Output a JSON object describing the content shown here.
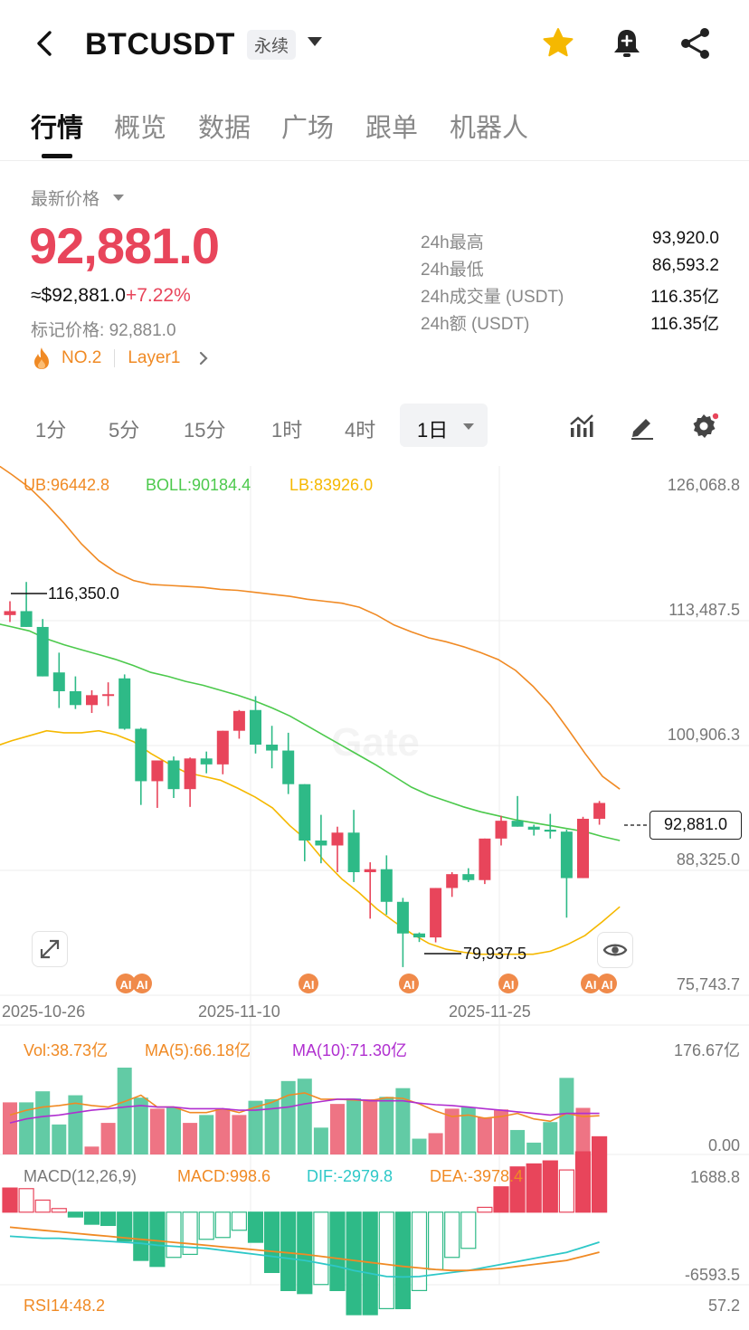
{
  "header": {
    "symbol": "BTCUSDT",
    "contract_type": "永续"
  },
  "tabs": [
    "行情",
    "概览",
    "数据",
    "广场",
    "跟单",
    "机器人"
  ],
  "price": {
    "label": "最新价格",
    "last": "92,881.0",
    "usd": "≈$92,881.0",
    "change": "+7.22%",
    "mark_label": "标记价格:",
    "mark": "92,881.0",
    "rank": "NO.2",
    "category": "Layer1",
    "up_color": "#e8455b",
    "down_color": "#2eba87"
  },
  "stats": [
    {
      "label": "24h最高",
      "value": "93,920.0"
    },
    {
      "label": "24h最低",
      "value": "86,593.2"
    },
    {
      "label": "24h成交量 (USDT)",
      "value": "116.35亿"
    },
    {
      "label": "24h额 (USDT)",
      "value": "116.35亿"
    }
  ],
  "intervals": [
    "1分",
    "5分",
    "15分",
    "1时",
    "4时"
  ],
  "active_interval": "1日",
  "indicators": {
    "boll": {
      "ub": "UB:96442.8",
      "mid": "BOLL:90184.4",
      "lb": "LB:83926.0"
    },
    "vol": {
      "vol": "Vol:38.73亿",
      "ma5": "MA(5):66.18亿",
      "ma10": "MA(10):71.30亿",
      "max": "176.67亿",
      "min": "0.00"
    },
    "macd": {
      "name": "MACD(12,26,9)",
      "macd": "MACD:998.6",
      "dif": "DIF:-2979.8",
      "dea": "DEA:-3978.4",
      "max": "1688.8",
      "min": "-6593.5"
    },
    "rsi": {
      "name": "RSI14:48.2",
      "max": "57.2"
    }
  },
  "chart_data": {
    "type": "candlestick",
    "price_axis": [
      "126,068.8",
      "113,487.5",
      "100,906.3",
      "88,325.0",
      "75,743.7"
    ],
    "ylim": [
      75743.7,
      126068.8
    ],
    "x_ticks": [
      "2025-10-26",
      "2025-11-10",
      "2025-11-25"
    ],
    "high_marker": "116,350.0",
    "low_marker": "79,937.5",
    "current_price": "92,881.0",
    "ai_markers": [
      "AI",
      "AI",
      "AI",
      "AI",
      "AI",
      "AI",
      "AI"
    ],
    "ohlc": [
      [
        113000,
        114400,
        112300,
        113400
      ],
      [
        113400,
        116350,
        112500,
        111800
      ],
      [
        111800,
        112600,
        106900,
        106800
      ],
      [
        107200,
        109200,
        103600,
        105300
      ],
      [
        105300,
        106800,
        103500,
        103900
      ],
      [
        103900,
        105400,
        103100,
        104900
      ],
      [
        104900,
        106200,
        103800,
        105000
      ],
      [
        106600,
        107000,
        101400,
        101500
      ],
      [
        101500,
        101600,
        93800,
        96200
      ],
      [
        96200,
        97800,
        93500,
        98300
      ],
      [
        98300,
        98700,
        94500,
        95400
      ],
      [
        95400,
        98600,
        93600,
        98500
      ],
      [
        98500,
        99200,
        97000,
        97900
      ],
      [
        97900,
        101300,
        96900,
        101300
      ],
      [
        101300,
        103400,
        100500,
        103300
      ],
      [
        103400,
        104800,
        99000,
        99900
      ],
      [
        99900,
        101800,
        97500,
        99300
      ],
      [
        99300,
        101100,
        94900,
        95900
      ],
      [
        95900,
        95900,
        88100,
        90200
      ],
      [
        90200,
        92800,
        87900,
        89700
      ],
      [
        89700,
        91600,
        87000,
        91000
      ],
      [
        91000,
        93300,
        86000,
        87000
      ],
      [
        87000,
        88000,
        82300,
        87300
      ],
      [
        87300,
        88700,
        82700,
        84000
      ],
      [
        84000,
        84400,
        77400,
        80800
      ],
      [
        80800,
        80900,
        79937.5,
        80400
      ],
      [
        80400,
        84500,
        79900,
        85400
      ],
      [
        85400,
        87000,
        84500,
        86800
      ],
      [
        86800,
        87400,
        86000,
        86200
      ],
      [
        86200,
        90100,
        85800,
        90400
      ],
      [
        90400,
        92700,
        89700,
        92200
      ],
      [
        92200,
        94700,
        91600,
        91600
      ],
      [
        91600,
        91800,
        90700,
        91300
      ],
      [
        91300,
        92900,
        90400,
        91100
      ],
      [
        91100,
        91300,
        82400,
        86400
      ],
      [
        86400,
        92600,
        86400,
        92400
      ],
      [
        92400,
        94200,
        91800,
        94000
      ]
    ],
    "ub": [
      128400,
      127200,
      125900,
      124200,
      122300,
      120200,
      118500,
      117300,
      116500,
      116100,
      116000,
      115900,
      115800,
      115600,
      115500,
      115300,
      115100,
      114900,
      114600,
      114400,
      114200,
      113800,
      113000,
      112000,
      111300,
      110700,
      110300,
      109800,
      109200,
      108500,
      107400,
      105800,
      103900,
      101500,
      99000,
      96700,
      95400
    ],
    "mid": [
      112200,
      111800,
      111400,
      110600,
      110000,
      109500,
      109000,
      108500,
      107900,
      107200,
      106800,
      106300,
      105900,
      105400,
      104900,
      104300,
      103600,
      102800,
      101800,
      100800,
      99800,
      98800,
      97800,
      96700,
      95600,
      94800,
      94200,
      93600,
      93100,
      92700,
      92300,
      92000,
      91700,
      91400,
      91100,
      90600,
      90200
    ],
    "lb": [
      99700,
      100300,
      100800,
      101300,
      101100,
      101100,
      101300,
      100900,
      100200,
      99000,
      98000,
      97100,
      96700,
      96300,
      95500,
      94600,
      93500,
      91700,
      90200,
      88100,
      86300,
      84900,
      83300,
      82000,
      80800,
      79800,
      79200,
      78900,
      78700,
      78700,
      78700,
      78700,
      79000,
      79700,
      80600,
      82000,
      83500
    ],
    "volume": [
      66,
      66,
      80,
      38,
      75,
      10,
      40,
      110,
      72,
      58,
      60,
      40,
      50,
      58,
      50,
      68,
      70,
      93,
      96,
      34,
      64,
      71,
      70,
      73,
      84,
      20,
      27,
      58,
      60,
      47,
      57,
      31,
      15,
      41,
      97,
      59,
      17
    ],
    "vol_ma5": [
      50,
      56,
      60,
      62,
      65,
      62,
      60,
      67,
      75,
      60,
      60,
      53,
      53,
      58,
      53,
      60,
      66,
      75,
      78,
      70,
      70,
      69,
      68,
      72,
      71,
      64,
      55,
      48,
      50,
      46,
      48,
      52,
      45,
      42,
      52,
      48,
      49
    ],
    "vol_ma10": [
      40,
      45,
      48,
      50,
      53,
      56,
      58,
      60,
      62,
      60,
      60,
      58,
      58,
      58,
      56,
      56,
      58,
      60,
      64,
      67,
      70,
      70,
      68,
      68,
      68,
      65,
      63,
      62,
      60,
      58,
      56,
      54,
      52,
      50,
      52,
      52,
      52
    ],
    "macd_hist": [
      400,
      390,
      200,
      60,
      -80,
      -200,
      -220,
      -480,
      -800,
      -900,
      -750,
      -700,
      -450,
      -420,
      -300,
      -500,
      -1000,
      -1300,
      -1350,
      -1200,
      -1300,
      -1700,
      -1700,
      -1600,
      -1600,
      -1300,
      -950,
      -750,
      -600,
      80,
      420,
      750,
      800,
      850,
      700,
      1000,
      1250
    ],
    "dif": [
      -2400,
      -2500,
      -2600,
      -2600,
      -2700,
      -2800,
      -2900,
      -3000,
      -3100,
      -3300,
      -3400,
      -3500,
      -3600,
      -3800,
      -4000,
      -4200,
      -4400,
      -4600,
      -4800,
      -5100,
      -5400,
      -5800,
      -6100,
      -6400,
      -6450,
      -6400,
      -6200,
      -6000,
      -5800,
      -5500,
      -5200,
      -4900,
      -4600,
      -4300,
      -4000,
      -3500,
      -2979.8
    ],
    "dea": [
      -1500,
      -1650,
      -1800,
      -1950,
      -2100,
      -2250,
      -2400,
      -2550,
      -2700,
      -2850,
      -3000,
      -3150,
      -3300,
      -3450,
      -3600,
      -3750,
      -3900,
      -4050,
      -4200,
      -4400,
      -4600,
      -4800,
      -5000,
      -5200,
      -5400,
      -5550,
      -5700,
      -5800,
      -5800,
      -5700,
      -5600,
      -5400,
      -5200,
      -5000,
      -4800,
      -4400,
      -3978.4
    ]
  }
}
